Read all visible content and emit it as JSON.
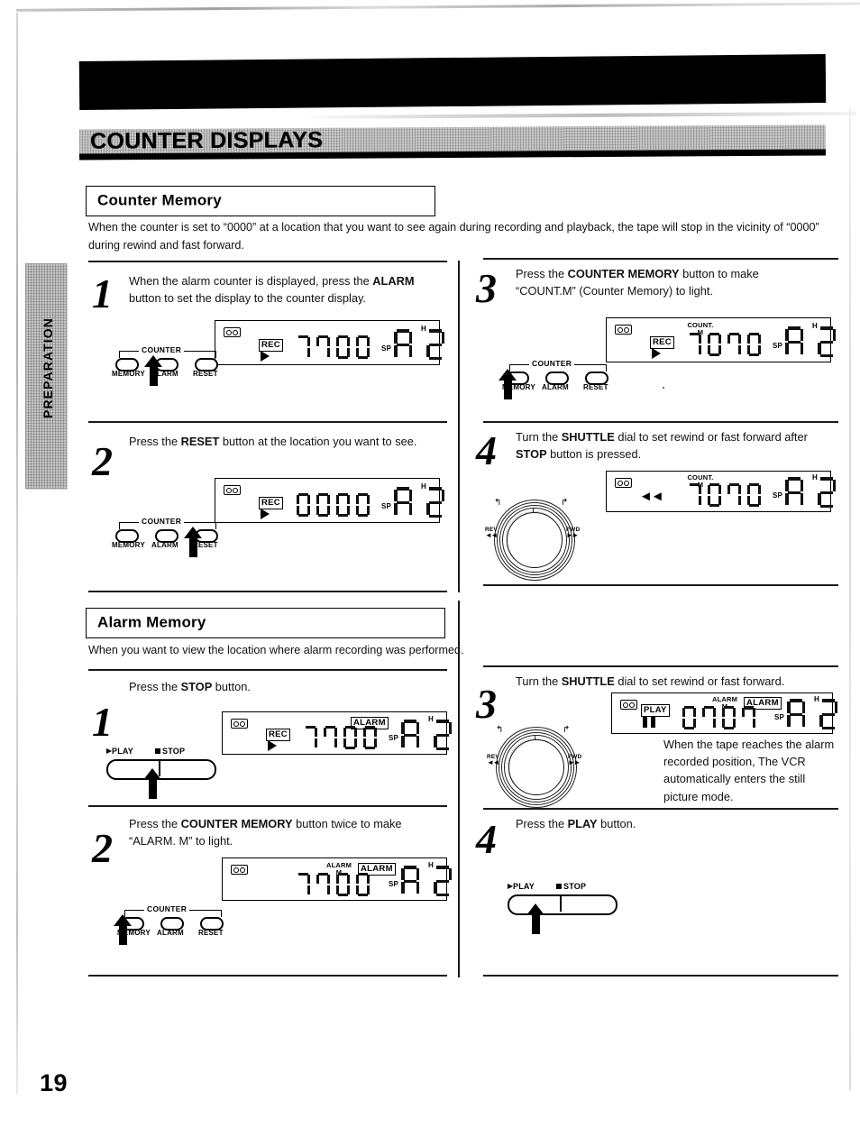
{
  "page": {
    "title": "COUNTER DISPLAYS",
    "side_tab": "PREPARATION",
    "number": "19"
  },
  "sections": [
    {
      "heading": "Counter Memory",
      "intro": "When the counter is set to “0000” at a location that you want to see again during recording and playback, the tape will stop in the vicinity of “0000” during rewind and fast forward."
    },
    {
      "heading": "Alarm Memory",
      "intro": "When you want to view the location where alarm recording was performed."
    }
  ],
  "counter_memory_steps": [
    {
      "num": "1",
      "text_parts": [
        "When the alarm counter is displayed, press the ",
        "ALARM",
        " button to set the display to the counter display."
      ],
      "display": {
        "cassette": true,
        "rec_badge": "REC",
        "transport": "play",
        "digits": "1700",
        "mode_label": "",
        "alarm_badge": "",
        "speed": "SP",
        "channel": "A",
        "channel_num": "2",
        "hour_label": "H"
      },
      "buttons": {
        "group_label": "COUNTER",
        "labels": [
          "MEMORY",
          "ALARM",
          "RESET"
        ],
        "pressed": "ALARM"
      }
    },
    {
      "num": "2",
      "text_parts": [
        "Press the ",
        "RESET",
        " button at the location you want to see."
      ],
      "display": {
        "cassette": true,
        "rec_badge": "REC",
        "transport": "play",
        "digits": "0000",
        "mode_label": "",
        "alarm_badge": "",
        "speed": "SP",
        "channel": "A",
        "channel_num": "2",
        "hour_label": "H"
      },
      "buttons": {
        "group_label": "COUNTER",
        "labels": [
          "MEMORY",
          "ALARM",
          "RESET"
        ],
        "pressed": "RESET"
      }
    },
    {
      "num": "3",
      "text_parts": [
        "Press the ",
        "COUNTER MEMORY",
        " button to make “COUNT.M” (Counter Memory) to light."
      ],
      "display": {
        "cassette": true,
        "rec_badge": "REC",
        "transport": "play",
        "digits": "1070",
        "mode_label": "COUNT.",
        "mode_sub": "M",
        "alarm_badge": "",
        "speed": "SP",
        "channel": "A",
        "channel_num": "2",
        "hour_label": "H"
      },
      "buttons": {
        "group_label": "COUNTER",
        "labels": [
          "MEMORY",
          "ALARM",
          "RESET"
        ],
        "pressed": "MEMORY"
      }
    },
    {
      "num": "4",
      "text_parts": [
        "Turn the ",
        "SHUTTLE",
        " dial to set rewind or fast forward after ",
        "STOP",
        " button is pressed."
      ],
      "display": {
        "cassette": true,
        "rec_badge": "",
        "transport": "rewind",
        "digits": "1070",
        "mode_label": "COUNT.",
        "mode_sub": "M",
        "alarm_badge": "",
        "speed": "SP",
        "channel": "A",
        "channel_num": "2",
        "hour_label": "H"
      },
      "shuttle": {
        "rev_label": "REV",
        "fwd_label": "FWD"
      }
    }
  ],
  "alarm_memory_steps": [
    {
      "num": "1",
      "text_parts": [
        "Press the ",
        "STOP",
        " button."
      ],
      "display": {
        "cassette": true,
        "rec_badge": "REC",
        "transport": "play",
        "digits": "1700",
        "mode_label": "",
        "alarm_badge": "ALARM",
        "speed": "SP",
        "channel": "A",
        "channel_num": "2",
        "hour_label": "H"
      },
      "rocker": {
        "play_label": "PLAY",
        "stop_label": "STOP",
        "pressed": "STOP"
      }
    },
    {
      "num": "2",
      "text_parts": [
        "Press the ",
        "COUNTER MEMORY",
        " button twice to make “ALARM. M” to light."
      ],
      "display": {
        "cassette": true,
        "rec_badge": "",
        "transport": "none",
        "digits": "1700",
        "mode_label": "ALARM",
        "mode_sub": "M",
        "alarm_badge": "ALARM",
        "speed": "SP",
        "channel": "A",
        "channel_num": "2",
        "hour_label": "H"
      },
      "buttons": {
        "group_label": "COUNTER",
        "labels": [
          "MEMORY",
          "ALARM",
          "RESET"
        ],
        "pressed": "MEMORY"
      }
    },
    {
      "num": "3",
      "text_parts": [
        "Turn the ",
        "SHUTTLE",
        " dial to set rewind or fast forward."
      ],
      "display": {
        "cassette": true,
        "rec_badge": "PLAY",
        "transport": "pause",
        "digits": "0707",
        "mode_label": "ALARM",
        "mode_sub": "M",
        "alarm_badge": "ALARM",
        "speed": "SP",
        "channel": "A",
        "channel_num": "2",
        "hour_label": "H"
      },
      "shuttle": {
        "rev_label": "REV",
        "fwd_label": "FWD"
      },
      "note": "When the tape reaches the alarm recorded position, The VCR automatically enters the still picture mode."
    },
    {
      "num": "4",
      "text_parts": [
        "Press the ",
        "PLAY",
        " button."
      ],
      "rocker": {
        "play_label": "PLAY",
        "stop_label": "STOP",
        "pressed": "PLAY"
      }
    }
  ]
}
